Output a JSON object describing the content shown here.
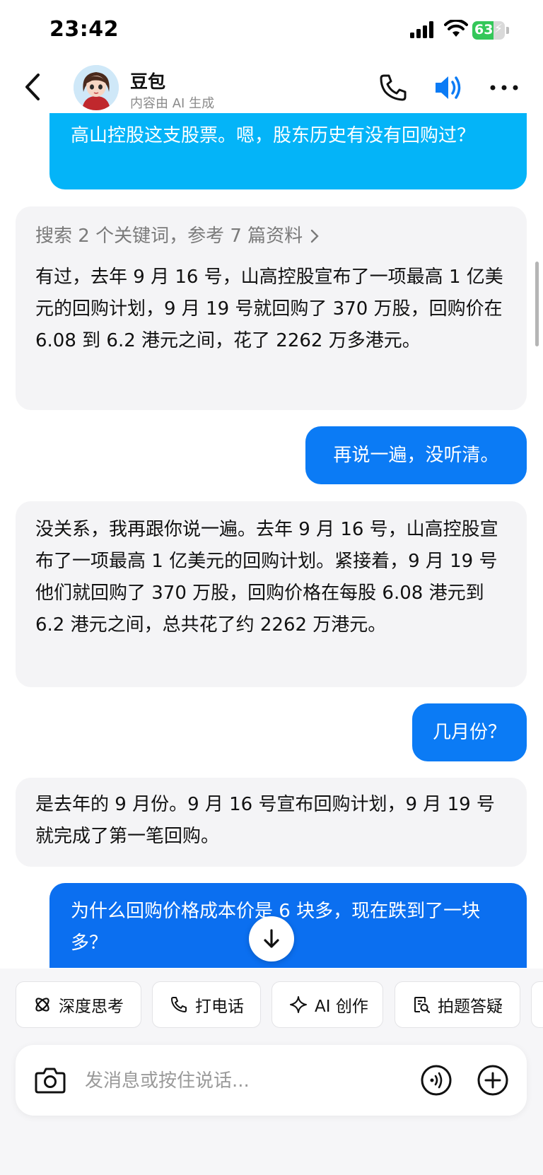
{
  "status_bar": {
    "time": "23:42",
    "battery": "63"
  },
  "header": {
    "name": "豆包",
    "subtitle": "内容由 AI 生成"
  },
  "messages": [
    {
      "role": "user",
      "text": "高山控股这支股票。嗯，股东历史有没有回购过？"
    },
    {
      "role": "assistant",
      "search": "搜索 2 个关键词，参考 7 篇资料",
      "text": "有过，去年 9 月 16 号，山高控股宣布了一项最高 1 亿美元的回购计划，9 月 19 号就回购了 370 万股，回购价在 6.08 到 6.2 港元之间，花了 2262 万多港元。"
    },
    {
      "role": "user",
      "text": "再说一遍，没听清。"
    },
    {
      "role": "assistant",
      "text": "没关系，我再跟你说一遍。去年 9 月 16 号，山高控股宣布了一项最高 1 亿美元的回购计划。紧接着，9 月 19 号他们就回购了 370 万股，回购价格在每股 6.08 港元到 6.2 港元之间，总共花了约 2262 万港元。"
    },
    {
      "role": "user",
      "text": "几月份？"
    },
    {
      "role": "assistant",
      "text": "是去年的 9 月份。9 月 16 号宣布回购计划，9 月 19 号就完成了第一笔回购。"
    },
    {
      "role": "user",
      "text": "为什么回购价格成本价是 6 块多，现在跌到了一块多？"
    }
  ],
  "quick_actions": [
    {
      "label": "深度思考",
      "icon": "atom-icon"
    },
    {
      "label": "打电话",
      "icon": "phone-icon"
    },
    {
      "label": "AI 创作",
      "icon": "sparkle-icon"
    },
    {
      "label": "拍题答疑",
      "icon": "search-doc-icon"
    }
  ],
  "input": {
    "placeholder": "发消息或按住说话..."
  },
  "colors": {
    "user_bubble": "#0b7bf5",
    "user_bubble_top": "#04b4f8",
    "ai_bubble": "#f4f4f6",
    "accent": "#0b7bf5"
  }
}
